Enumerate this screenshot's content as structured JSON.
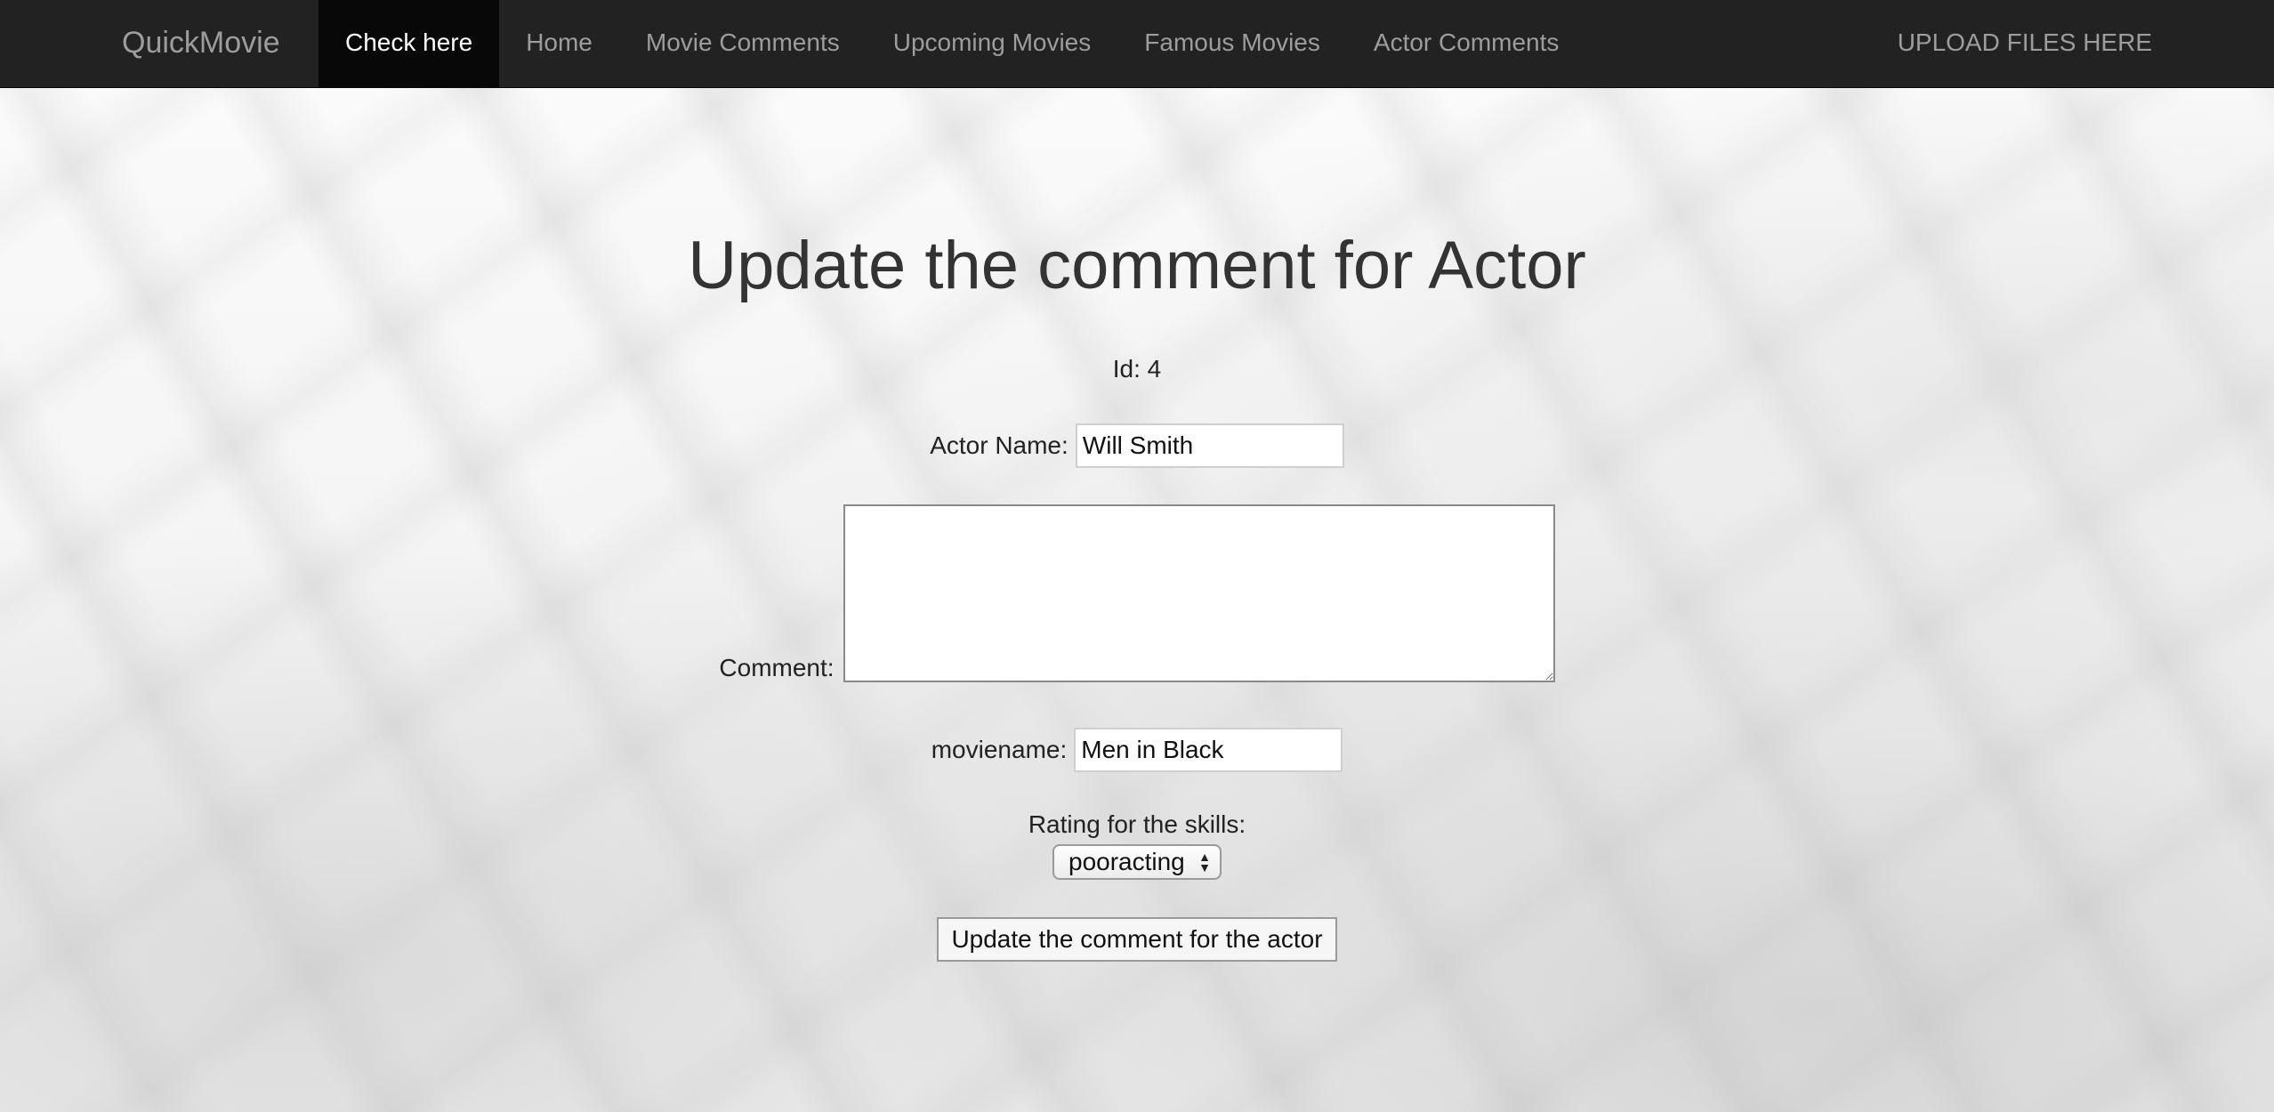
{
  "navbar": {
    "brand": "QuickMovie",
    "items": [
      {
        "label": "Check here",
        "active": true
      },
      {
        "label": "Home",
        "active": false
      },
      {
        "label": "Movie Comments",
        "active": false
      },
      {
        "label": "Upcoming Movies",
        "active": false
      },
      {
        "label": "Famous Movies",
        "active": false
      },
      {
        "label": "Actor Comments",
        "active": false
      }
    ],
    "right_link": "UPLOAD FILES HERE",
    "colors": {
      "background": "#222222",
      "active_background": "#080808",
      "link": "#9d9d9d",
      "active_link": "#ffffff"
    }
  },
  "page": {
    "title": "Update the comment for Actor",
    "id_label": "Id: 4",
    "actor_name_label": "Actor Name:",
    "actor_name_value": "Will Smith",
    "comment_label": "Comment:",
    "comment_value": "",
    "moviename_label": "moviename:",
    "moviename_value": "Men in Black",
    "rating_label": "Rating for the skills:",
    "rating_selected": "pooracting",
    "submit_label": "Update the comment for the actor"
  }
}
